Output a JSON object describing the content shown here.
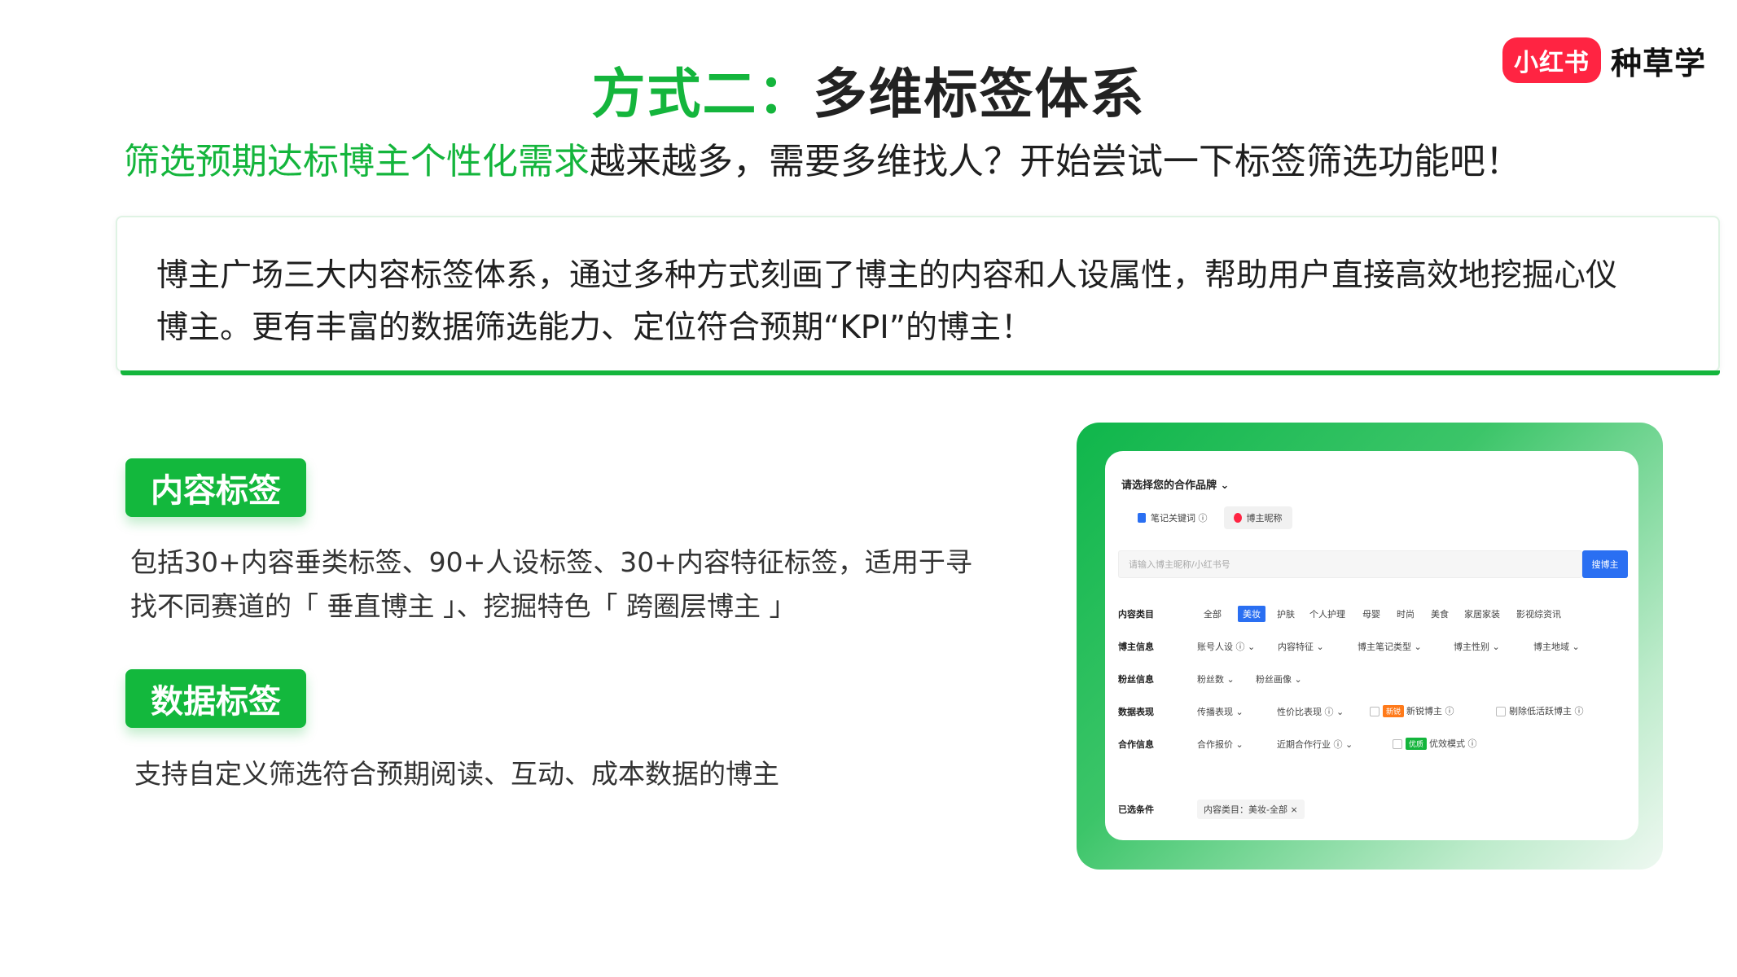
{
  "title": {
    "part1": "方式二：",
    "part2": "多维标签体系"
  },
  "brand": {
    "badge": "小红书",
    "word": "种草学"
  },
  "subtitle": {
    "green": "筛选预期达标博主个性化需求",
    "dark": "越来越多，需要多维找人？开始尝试一下标签筛选功能吧！"
  },
  "description": {
    "line1": "博主广场三大内容标签体系，通过多种方式刻画了博主的内容和人设属性，帮助用户直接高效地挖掘心仪",
    "line2": "博主。更有丰富的数据筛选能力、定位符合预期“KPI”的博主！"
  },
  "content_tag": {
    "label": "内容标签",
    "line1": "包括30+内容垂类标签、90+人设标签、30+内容特征标签，适用于寻",
    "line2": "找不同赛道的「 垂直博主 」、挖掘特色「 跨圈层博主 」"
  },
  "data_tag": {
    "label": "数据标签",
    "desc": "支持自定义筛选符合预期阅读、互动、成本数据的博主"
  },
  "panel": {
    "brand_select": "请选择您的合作品牌 ⌄",
    "tabs": [
      {
        "label": "笔记关键词 ⓘ",
        "icon": "note-icon",
        "color": "#2a6ff2"
      },
      {
        "label": "博主昵称",
        "icon": "user-icon",
        "color": "#ff2442"
      }
    ],
    "search_placeholder": "请输入博主昵称/小红书号",
    "search_button": "搜博主",
    "rows": [
      {
        "label": "内容类目",
        "items": [
          "全部",
          "美妆",
          "护肤",
          "个人护理",
          "母婴",
          "时尚",
          "美食",
          "家居家装",
          "影视综资讯"
        ],
        "selected": 1
      },
      {
        "label": "博主信息",
        "items": [
          "账号人设 ⓘ ⌄",
          "内容特征 ⌄",
          "博主笔记类型 ⌄",
          "博主性别 ⌄",
          "博主地域 ⌄"
        ]
      },
      {
        "label": "粉丝信息",
        "items": [
          "粉丝数 ⌄",
          "粉丝画像 ⌄"
        ]
      },
      {
        "label": "数据表现",
        "items": [
          "传播表现 ⌄",
          "性价比表现 ⓘ ⌄"
        ],
        "check1_badge": "新锐",
        "check1": "新锐博主 ⓘ",
        "check2": "剔除低活跃博主 ⓘ"
      },
      {
        "label": "合作信息",
        "items": [
          "合作报价 ⌄",
          "近期合作行业 ⓘ ⌄"
        ],
        "check1_badge": "优质",
        "check1": "优效模式 ⓘ"
      }
    ],
    "conditions_label": "已选条件",
    "condition_chip": "内容类目：美妆-全部 ×"
  }
}
